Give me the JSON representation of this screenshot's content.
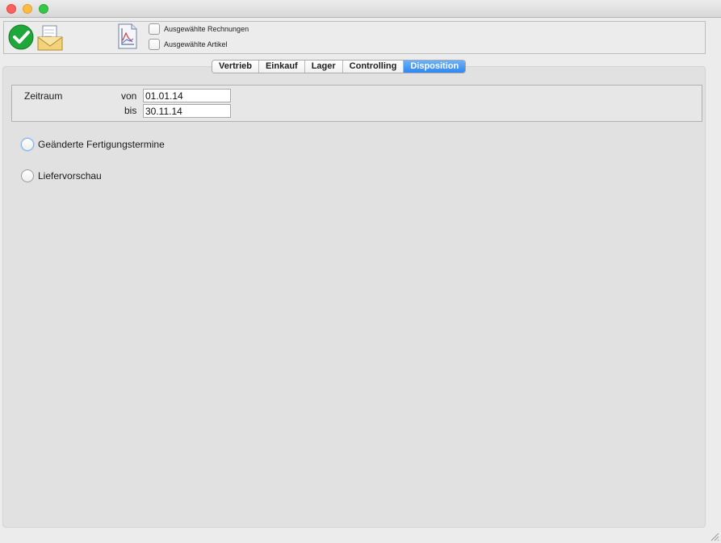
{
  "window": {
    "controls": [
      "close",
      "minimize",
      "zoom"
    ]
  },
  "toolbar": {
    "icons": [
      "checkmark-icon",
      "mail-document-icon",
      "chart-document-icon"
    ],
    "checkboxes": [
      {
        "label": "Ausgewählte Rechnungen",
        "checked": false
      },
      {
        "label": "Ausgewählte Artikel",
        "checked": false
      }
    ]
  },
  "tabs": [
    {
      "label": "Vertrieb",
      "active": false
    },
    {
      "label": "Einkauf",
      "active": false
    },
    {
      "label": "Lager",
      "active": false
    },
    {
      "label": "Controlling",
      "active": false
    },
    {
      "label": "Disposition",
      "active": true
    }
  ],
  "zeitraum": {
    "label": "Zeitraum",
    "von_label": "von",
    "von_value": "01.01.14",
    "bis_label": "bis",
    "bis_value": "30.11.14"
  },
  "options": [
    {
      "label": "Geänderte Fertigungstermine",
      "selected": false
    },
    {
      "label": "Liefervorschau",
      "selected": false
    }
  ],
  "colors": {
    "active_tab": "#2f87f2",
    "check_green": "#1fa83a"
  }
}
